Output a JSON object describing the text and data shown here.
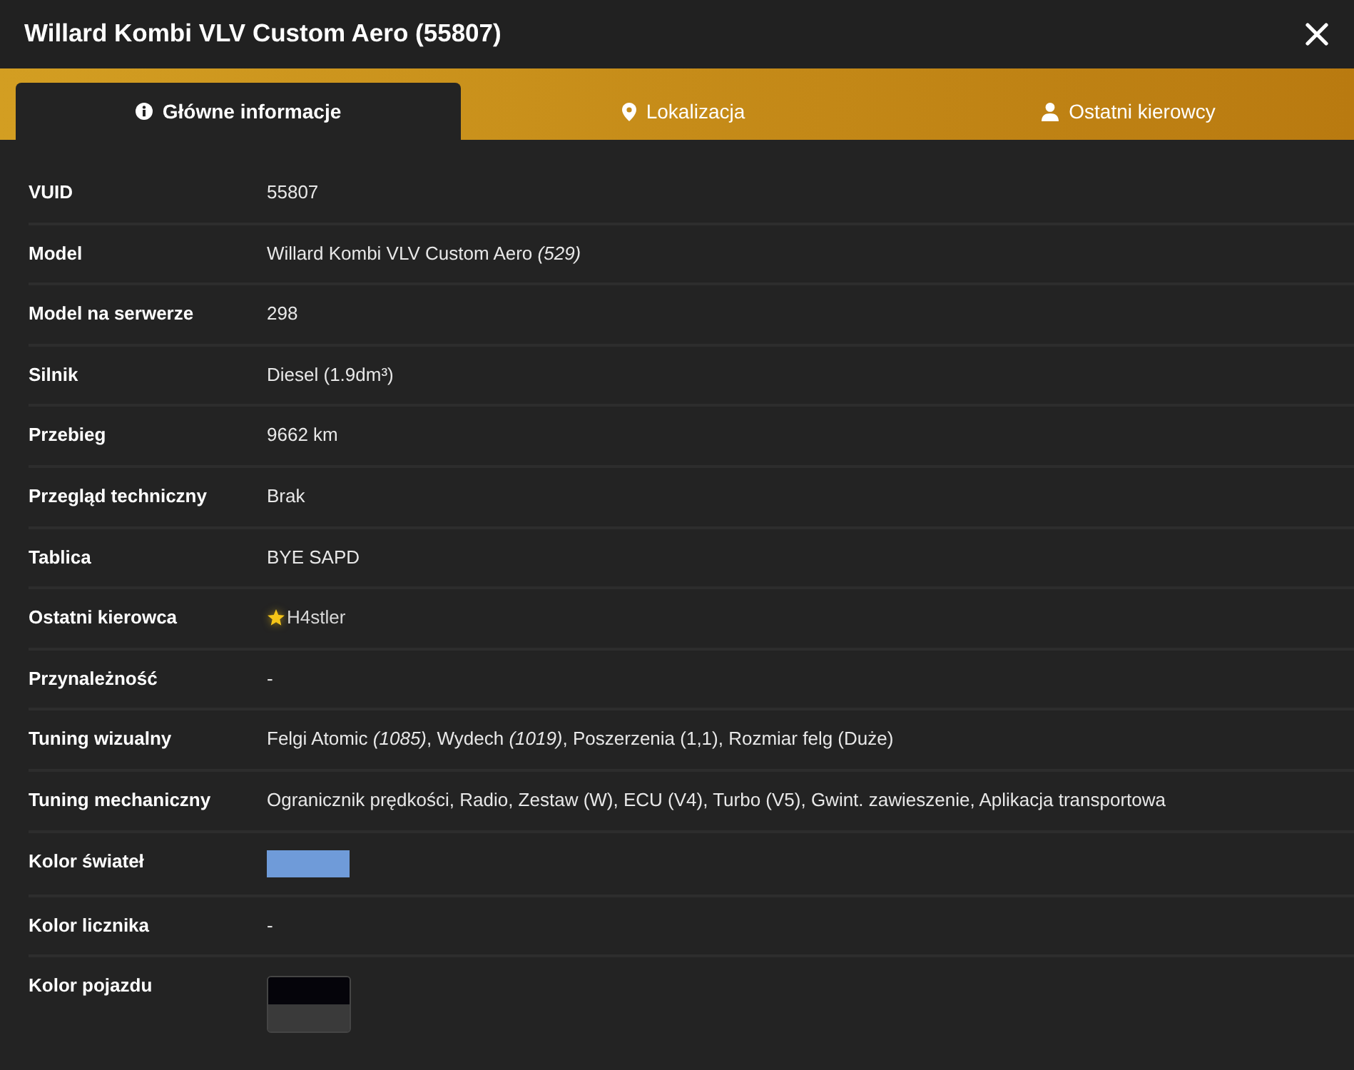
{
  "window": {
    "title": "Willard Kombi VLV Custom Aero (55807)"
  },
  "tabs": [
    {
      "label": "Główne informacje",
      "selected": true
    },
    {
      "label": "Lokalizacja",
      "selected": false
    },
    {
      "label": "Ostatni kierowcy",
      "selected": false
    }
  ],
  "rows": [
    {
      "kind": "text",
      "label": "VUID",
      "value": "55807"
    },
    {
      "kind": "text",
      "label": "Model",
      "value": "Willard Kombi VLV Custom Aero *(529)*"
    },
    {
      "kind": "text",
      "label": "Model na serwerze",
      "value": "298"
    },
    {
      "kind": "text",
      "label": "Silnik",
      "value": "Diesel (1.9dm³)"
    },
    {
      "kind": "text",
      "label": "Przebieg",
      "value": "9662 km"
    },
    {
      "kind": "text",
      "label": "Przegląd techniczny",
      "value": "Brak"
    },
    {
      "kind": "text",
      "label": "Tablica",
      "value": "BYE SAPD"
    },
    {
      "kind": "driver",
      "label": "Ostatni kierowca",
      "value": "H4stler",
      "starred": true
    },
    {
      "kind": "text",
      "label": "Przynależność",
      "value": "-"
    },
    {
      "kind": "text",
      "label": "Tuning wizualny",
      "value": "Felgi Atomic *(1085)*, Wydech *(1019)*, Poszerzenia (1,1), Rozmiar felg (Duże)"
    },
    {
      "kind": "text",
      "label": "Tuning mechaniczny",
      "value": "Ogranicznik prędkości, Radio, Zestaw (W), ECU (V4), Turbo (V5), Gwint. zawieszenie, Aplikacja transportowa"
    },
    {
      "kind": "swatch",
      "label": "Kolor świateł",
      "color": "#6f9bd9"
    },
    {
      "kind": "text",
      "label": "Kolor licznika",
      "value": "-"
    },
    {
      "kind": "split_swatch",
      "label": "Kolor pojazdu",
      "swatches": [
        {
          "color": "#05040a"
        },
        {
          "color": "#3a3a3a"
        }
      ]
    }
  ]
}
